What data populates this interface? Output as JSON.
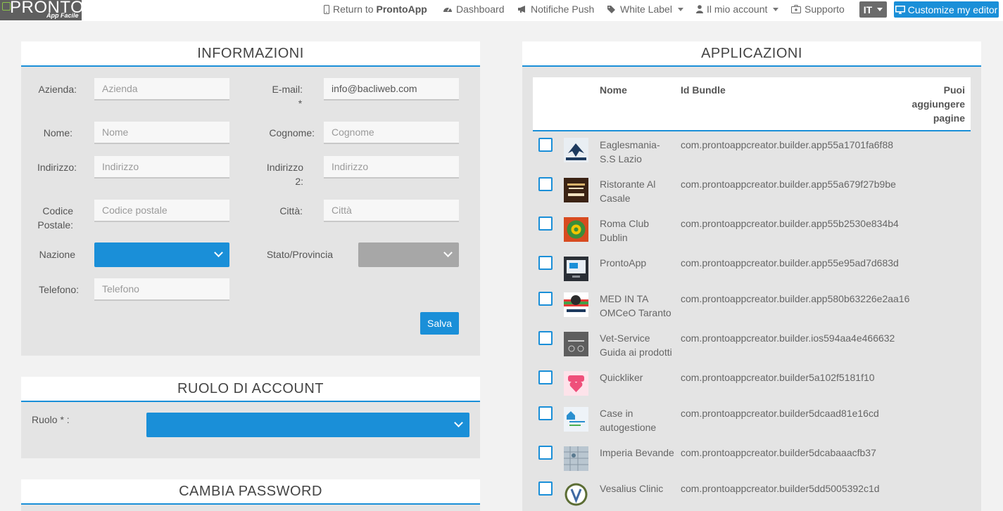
{
  "navbar": {
    "logo_text": "PRONTO",
    "logo_subtext": "App Facile",
    "return_prefix": "Return to ",
    "return_app": "ProntoApp",
    "dashboard": "Dashboard",
    "notifications": "Notifiche Push",
    "white_label": "White Label",
    "account": "Il mio account",
    "support": "Supporto",
    "language": "IT",
    "customize": "Customize my editor"
  },
  "info": {
    "title": "INFORMAZIONI",
    "azienda_label": "Azienda:",
    "azienda_placeholder": "Azienda",
    "email_label": "E-mail:",
    "email_required": "*",
    "email_value": "info@bacliweb.com",
    "nome_label": "Nome:",
    "nome_placeholder": "Nome",
    "cognome_label": "Cognome:",
    "cognome_placeholder": "Cognome",
    "indirizzo_label": "Indirizzo:",
    "indirizzo_placeholder": "Indirizzo",
    "indirizzo2_label_a": "Indirizzo",
    "indirizzo2_label_b": "2:",
    "indirizzo2_placeholder": "Indirizzo",
    "cap_label_a": "Codice",
    "cap_label_b": "Postale:",
    "cap_placeholder": "Codice postale",
    "citta_label": "Città:",
    "citta_placeholder": "Città",
    "nazione_label": "Nazione",
    "stato_label": "Stato/Provincia",
    "telefono_label": "Telefono:",
    "telefono_placeholder": "Telefono",
    "save": "Salva"
  },
  "role": {
    "title": "RUOLO DI ACCOUNT",
    "label": "Ruolo * :"
  },
  "password": {
    "title": "CAMBIA PASSWORD"
  },
  "apps": {
    "title": "APPLICAZIONI",
    "col_name": "Nome",
    "col_bundle": "Id Bundle",
    "col_pages_a": "Puoi",
    "col_pages_b": "aggiungere",
    "col_pages_c": "pagine",
    "rows": [
      {
        "name_a": "Eaglesmania-",
        "name_b": "S.S Lazio",
        "bundle": "com.prontoappcreator.builder.app55a1701fa6f88",
        "icon": "eagle-icon"
      },
      {
        "name_a": "Ristorante Al",
        "name_b": "Casale",
        "bundle": "com.prontoappcreator.builder.app55a679f27b9be",
        "icon": "restaurant-icon"
      },
      {
        "name_a": "Roma Club",
        "name_b": "Dublin",
        "bundle": "com.prontoappcreator.builder.app55b2530e834b4",
        "icon": "clover-icon"
      },
      {
        "name_a": "ProntoApp",
        "name_b": "",
        "bundle": "com.prontoappcreator.builder.app55e95ad7d683d",
        "icon": "monitor-icon"
      },
      {
        "name_a": "MED IN TA",
        "name_b": "OMCeO Taranto",
        "bundle": "com.prontoappcreator.builder.app580b63226e2aa16",
        "icon": "medical-icon"
      },
      {
        "name_a": "Vet-Service",
        "name_b": "Guida ai prodotti",
        "bundle": "com.prontoappcreator.builder.ios594aa4e466632",
        "icon": "vet-icon"
      },
      {
        "name_a": "Quickliker",
        "name_b": "",
        "bundle": "com.prontoappcreator.builder5a102f5181f10",
        "icon": "heart-icon"
      },
      {
        "name_a": "Case in",
        "name_b": "autogestione",
        "bundle": "com.prontoappcreator.builder5dcaad81e16cd",
        "icon": "house-icon"
      },
      {
        "name_a": "Imperia Bevande",
        "name_b": "",
        "bundle": "com.prontoappcreator.builder5dcabaaacfb37",
        "icon": "map-icon"
      },
      {
        "name_a": "Vesalius Clinic",
        "name_b": "",
        "bundle": "com.prontoappcreator.builder5dd5005392c1d",
        "icon": "clinic-icon"
      }
    ]
  }
}
